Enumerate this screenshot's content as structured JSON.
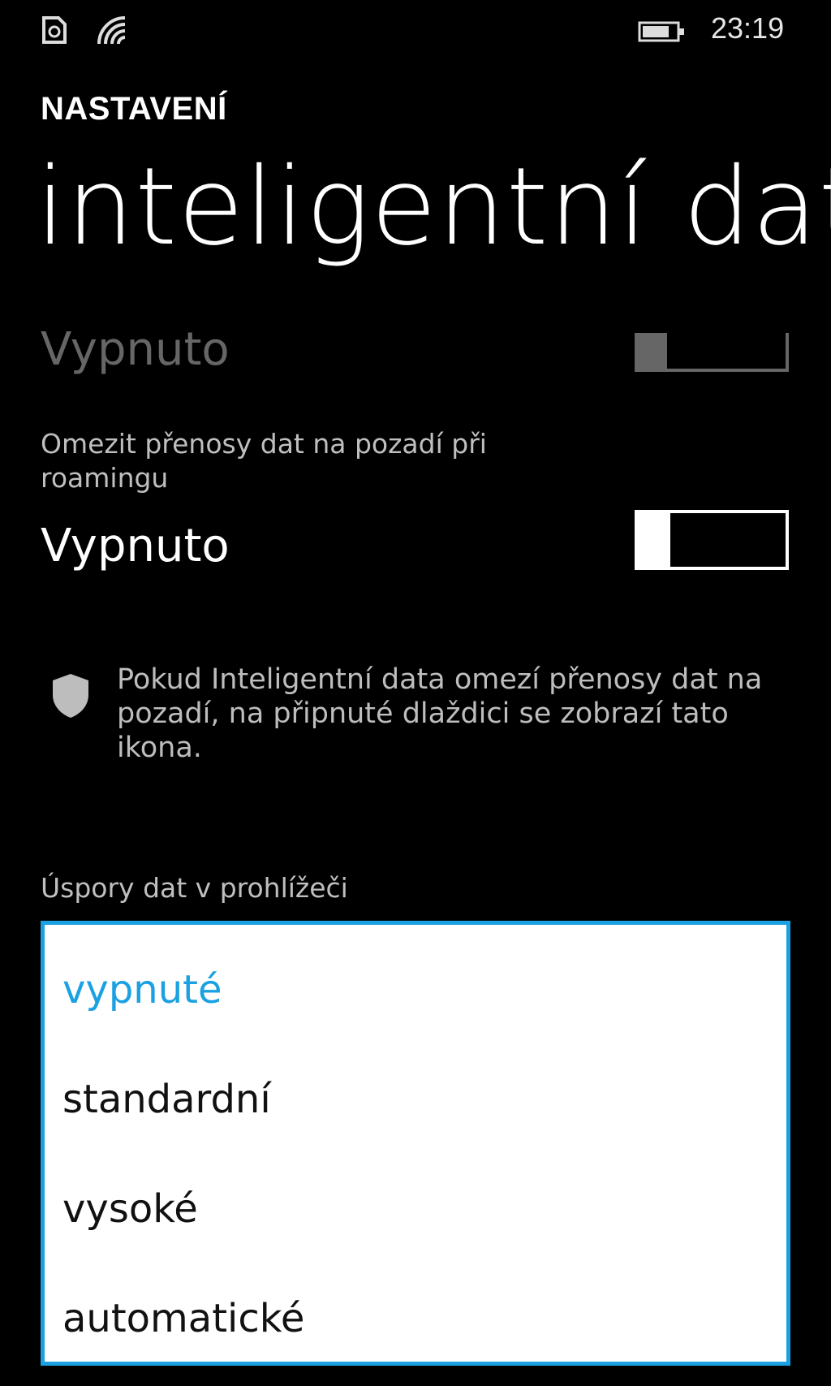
{
  "status_bar": {
    "time": "23:19",
    "icons": [
      "sim-icon",
      "wifi-icon",
      "battery-icon"
    ]
  },
  "header": {
    "app_title": "NASTAVENÍ",
    "page_title": "inteligentní dat"
  },
  "toggles": {
    "main": {
      "state_label": "Vypnuto",
      "enabled": false,
      "on": false
    },
    "roaming": {
      "label": "Omezit přenosy dat na pozadí při roamingu",
      "state_label": "Vypnuto",
      "enabled": true,
      "on": false
    }
  },
  "info": {
    "icon": "shield-icon",
    "text": "Pokud Inteligentní data omezí přenosy dat na pozadí, na připnuté dlaždici se zobrazí tato ikona."
  },
  "browser_savings": {
    "label": "Úspory dat v prohlížeči",
    "options": [
      "vypnuté",
      "standardní",
      "vysoké",
      "automatické"
    ],
    "selected": "vypnuté"
  },
  "colors": {
    "accent": "#1ba1e2",
    "background": "#000000",
    "disabled": "#666666"
  }
}
